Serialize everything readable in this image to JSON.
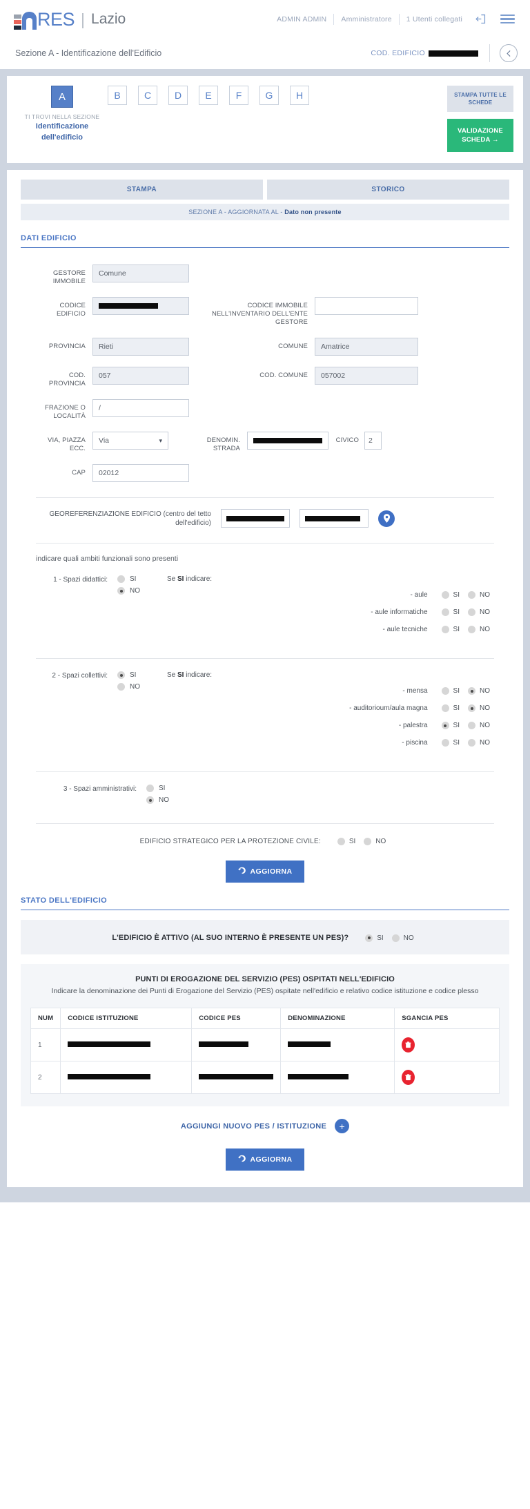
{
  "topbar": {
    "logo_text": "RES",
    "logo_separator": "|",
    "region": "Lazio",
    "user": "ADMIN ADMIN",
    "role": "Amministratore",
    "connected": "1 Utenti collegati",
    "logout_icon": "logout-icon",
    "menu_icon": "hamburger-menu-icon"
  },
  "section_header": {
    "title": "Sezione A - Identificazione dell'Edificio",
    "cod_label": "COD. EDIFICIO",
    "cod_value_redacted": true,
    "back_icon": "arrow-left-circle-icon"
  },
  "section_tabs": {
    "active": "A",
    "letters": [
      "B",
      "C",
      "D",
      "E",
      "F",
      "G",
      "H"
    ],
    "you_are_in": "TI TROVI NELLA SEZIONE",
    "current_name_line1": "Identificazione",
    "current_name_line2": "dell'edificio",
    "print_all_label": "STAMPA TUTTE LE SCHEDE",
    "validate_label": "VALIDAZIONE SCHEDA",
    "validate_arrow": "→",
    "validate_color": "#2ab87a"
  },
  "form_tabs": {
    "stampa": "STAMPA",
    "storico": "STORICO",
    "updated_prefix": "SEZIONE A - AGGIORNATA AL -",
    "updated_value": "Dato non presente"
  },
  "dati_edificio": {
    "heading": "DATI EDIFICIO",
    "fields": {
      "gestore_immobile_label": "GESTORE IMMOBILE",
      "gestore_immobile_value": "Comune",
      "codice_edificio_label": "CODICE EDIFICIO",
      "codice_edificio_value": "",
      "codice_inventario_label": "CODICE IMMOBILE NELL'INVENTARIO DELL'ENTE GESTORE",
      "codice_inventario_value": "",
      "provincia_label": "PROVINCIA",
      "provincia_value": "Rieti",
      "comune_label": "COMUNE",
      "comune_value": "Amatrice",
      "cod_provincia_label": "COD. PROVINCIA",
      "cod_provincia_value": "057",
      "cod_comune_label": "COD. COMUNE",
      "cod_comune_value": "057002",
      "frazione_label": "FRAZIONE O LOCALITÀ",
      "frazione_value": "/",
      "via_label": "VIA, PIAZZA ECC.",
      "via_value": "Via",
      "denomin_strada_label": "DENOMIN. STRADA",
      "denomin_strada_value": "",
      "civico_label": "CIVICO",
      "civico_value": "2",
      "cap_label": "CAP",
      "cap_value": "02012"
    },
    "georeferenziazione": {
      "label": "GEOREFERENZIAZIONE EDIFICIO (centro del tetto dell'edificio)",
      "lat_value": "",
      "lon_value": "",
      "map_icon": "map-pin-icon"
    },
    "ambiti_note": "indicare quali ambiti funzionali sono presenti",
    "se_si_indicare": "Se SI indicare:",
    "si": "SI",
    "no": "NO",
    "groups": [
      {
        "question": "1 - Spazi didattici:",
        "answer": "NO",
        "sub": [
          {
            "label": "- aule",
            "answer": ""
          },
          {
            "label": "- aule informatiche",
            "answer": ""
          },
          {
            "label": "- aule tecniche",
            "answer": ""
          }
        ]
      },
      {
        "question": "2 - Spazi collettivi:",
        "answer": "SI",
        "sub": [
          {
            "label": "- mensa",
            "answer": "NO"
          },
          {
            "label": "- auditorioum/aula magna",
            "answer": "NO"
          },
          {
            "label": "- palestra",
            "answer": "SI"
          },
          {
            "label": "- piscina",
            "answer": ""
          }
        ]
      },
      {
        "question": "3 - Spazi amministrativi:",
        "answer": "NO",
        "sub": []
      }
    ],
    "strategico_label": "EDIFICIO STRATEGICO PER LA PROTEZIONE CIVILE:",
    "strategico_answer": "",
    "aggiorna_label": "AGGIORNA",
    "aggiorna_icon": "refresh-icon"
  },
  "stato_edificio": {
    "heading": "STATO DELL'EDIFICIO",
    "attivo_question": "L'EDIFICIO È ATTIVO (AL SUO INTERNO È PRESENTE UN PES)?",
    "attivo_answer": "SI",
    "si": "SI",
    "no": "NO",
    "pes_title": "PUNTI DI EROGAZIONE DEL SERVIZIO (PES) OSPITATI NELL'EDIFICIO",
    "pes_subtitle": "Indicare la denominazione dei Punti di Erogazione del Servizio (PES) ospitate nell'edificio e relativo codice istituzione e codice plesso",
    "table": {
      "columns": [
        "NUM",
        "CODICE ISTITUZIONE",
        "CODICE PES",
        "DENOMINAZIONE",
        "SGANCIA PES"
      ],
      "rows": [
        {
          "num": "1",
          "codice_istituzione": "",
          "codice_pes": "",
          "denominazione": "",
          "action_icon": "trash-icon"
        },
        {
          "num": "2",
          "codice_istituzione": "",
          "codice_pes": "",
          "denominazione": "",
          "action_icon": "trash-icon"
        }
      ]
    },
    "add_label": "AGGIUNGI NUOVO PES / ISTITUZIONE",
    "add_icon": "plus-circle-icon",
    "aggiorna_label": "AGGIORNA",
    "aggiorna_icon": "refresh-icon"
  }
}
